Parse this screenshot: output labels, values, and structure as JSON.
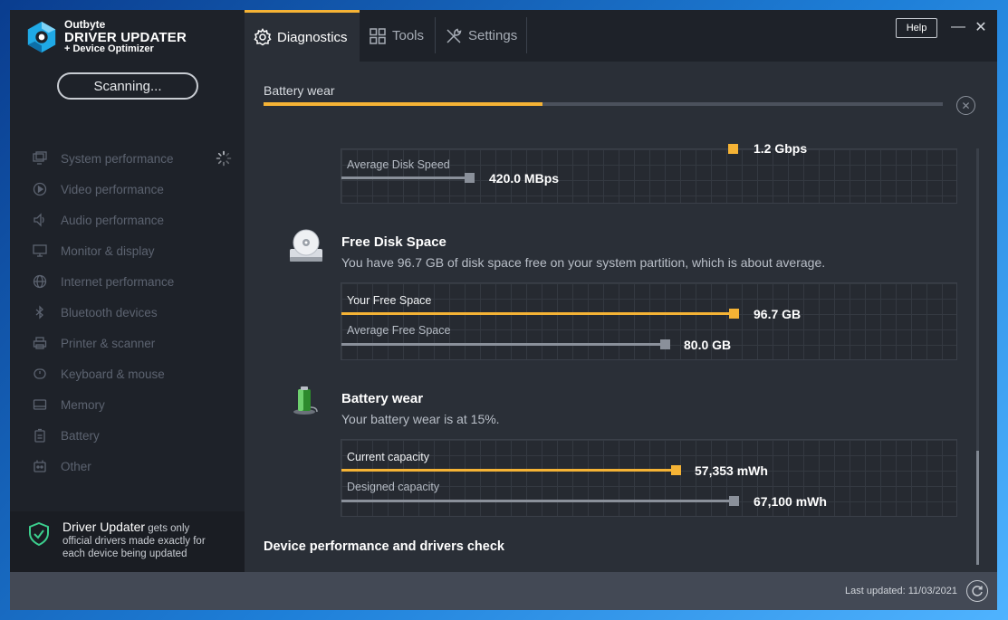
{
  "app": {
    "brand_top": "Outbyte",
    "brand_main": "DRIVER UPDATER",
    "brand_sub": "+ Device Optimizer",
    "scan_button": "Scanning..."
  },
  "sidebar": {
    "items": [
      {
        "label": "System performance",
        "icon": "monitor-icon"
      },
      {
        "label": "Video performance",
        "icon": "play-icon"
      },
      {
        "label": "Audio performance",
        "icon": "speaker-icon"
      },
      {
        "label": "Monitor & display",
        "icon": "display-icon"
      },
      {
        "label": "Internet performance",
        "icon": "globe-icon"
      },
      {
        "label": "Bluetooth devices",
        "icon": "bluetooth-icon"
      },
      {
        "label": "Printer & scanner",
        "icon": "printer-icon"
      },
      {
        "label": "Keyboard & mouse",
        "icon": "mouse-icon"
      },
      {
        "label": "Memory",
        "icon": "memory-icon"
      },
      {
        "label": "Battery",
        "icon": "battery-icon"
      },
      {
        "label": "Other",
        "icon": "other-icon"
      }
    ],
    "footer_title": "Driver Updater",
    "footer_text_1": " gets only",
    "footer_text_2": "official drivers made exactly for",
    "footer_text_3": "each device being updated"
  },
  "tabs": [
    {
      "label": "Diagnostics",
      "active": true
    },
    {
      "label": "Tools",
      "active": false
    },
    {
      "label": "Settings",
      "active": false
    }
  ],
  "window": {
    "help": "Help",
    "minimize": "—",
    "close": "✕"
  },
  "progress": {
    "label": "Battery wear",
    "fraction": 0.41
  },
  "disk_speed": {
    "partial_value": "1.2 Gbps",
    "avg_label": "Average Disk Speed",
    "avg_value": "420.0 MBps"
  },
  "free_disk": {
    "title": "Free Disk Space",
    "desc": "You have 96.7 GB of disk space free on your system partition, which is about average.",
    "yours_label": "Your Free Space",
    "yours_value": "96.7 GB",
    "avg_label": "Average Free Space",
    "avg_value": "80.0 GB"
  },
  "battery": {
    "title": "Battery wear",
    "desc": "Your battery wear is at 15%.",
    "current_label": "Current capacity",
    "current_value": "57,353 mWh",
    "designed_label": "Designed capacity",
    "designed_value": "67,100 mWh"
  },
  "bottom_heading": "Device performance and drivers check",
  "status": {
    "last_updated": "Last updated: 11/03/2021"
  },
  "colors": {
    "accent": "#f5b335",
    "sidebar_bg": "#1e2229",
    "main_bg": "#2a2f37"
  }
}
